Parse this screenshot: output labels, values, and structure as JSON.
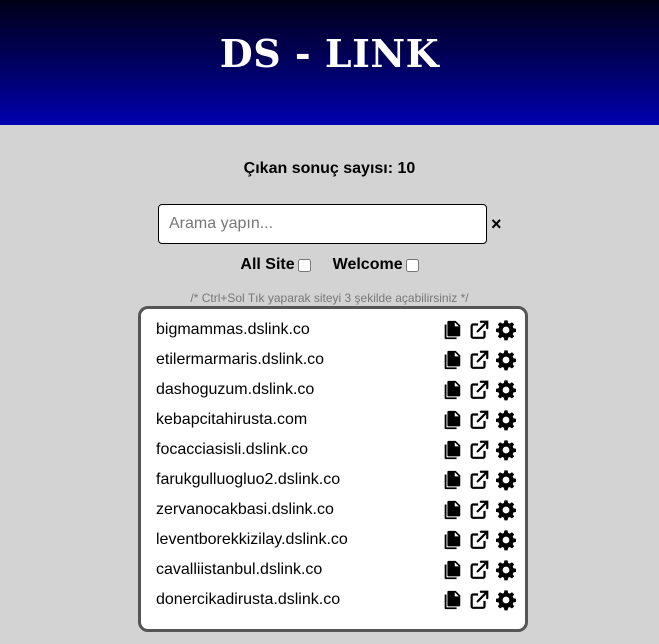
{
  "header": {
    "title": "DS - LINK"
  },
  "result_count": "Çıkan sonuç sayısı: 10",
  "search": {
    "placeholder": "Arama yapın...",
    "value": "",
    "clear_label": "×"
  },
  "filters": [
    {
      "label": "All Site",
      "checked": false
    },
    {
      "label": "Welcome",
      "checked": false
    }
  ],
  "hint": "/* Ctrl+Sol Tık yaparak siteyi 3 şekilde açabilirsiniz */",
  "sites": [
    {
      "name": "bigmammas.dslink.co"
    },
    {
      "name": "etilermarmaris.dslink.co"
    },
    {
      "name": "dashoguzum.dslink.co"
    },
    {
      "name": "kebapcitahirusta.com"
    },
    {
      "name": "focacciasisli.dslink.co"
    },
    {
      "name": "farukgulluogluo2.dslink.co"
    },
    {
      "name": "zervanocakbasi.dslink.co"
    },
    {
      "name": "leventborekkizilay.dslink.co"
    },
    {
      "name": "cavalliistanbul.dslink.co"
    },
    {
      "name": "donercikadirusta.dslink.co"
    }
  ],
  "row_icons": [
    "copy-icon",
    "external-link-icon",
    "gear-icon"
  ],
  "colors": {
    "header_top": "#000018",
    "header_bottom": "#0000b0",
    "background": "#d3d3d3",
    "list_border": "#555555"
  }
}
